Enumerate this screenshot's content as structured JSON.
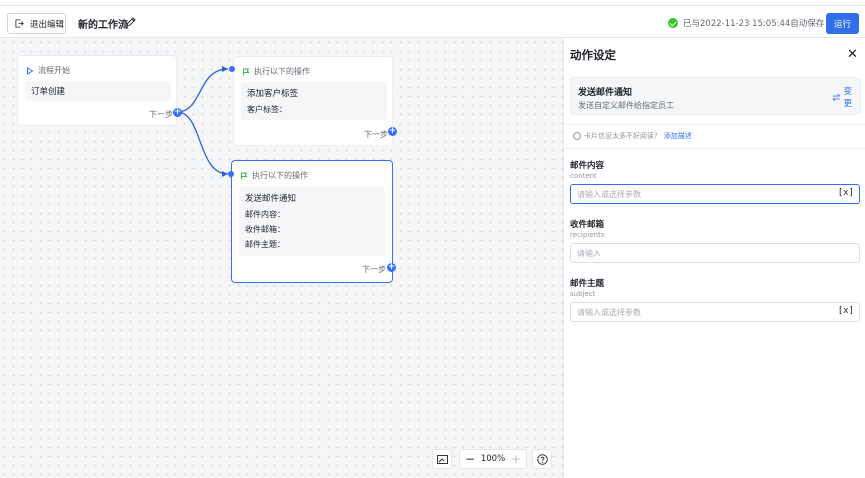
{
  "header": {
    "exit_label": "退出编辑",
    "title": "新的工作流",
    "save_status": "已与2022-11-23 15:05:44自动保存",
    "run_label": "运行"
  },
  "canvas": {
    "start_node": {
      "header": "流程开始",
      "title": "订单创建",
      "next": "下一步"
    },
    "node_tag": {
      "header": "执行以下的操作",
      "title": "添加客户标签",
      "fields": [
        "客户标签："
      ],
      "next": "下一步"
    },
    "node_email": {
      "header": "执行以下的操作",
      "title": "发送邮件通知",
      "fields": [
        "邮件内容：",
        "收件邮箱：",
        "邮件主题："
      ],
      "next": "下一步"
    },
    "zoom_level": "100%"
  },
  "panel": {
    "title": "动作设定",
    "action": {
      "name": "发送邮件通知",
      "desc": "发送自定义邮件给指定员工",
      "change_label": "变更"
    },
    "hint": {
      "text": "卡片信息太多不好阅读?",
      "link": "添加描述"
    },
    "fields": [
      {
        "label": "邮件内容",
        "key": "content",
        "placeholder": "请输入或选择参数",
        "var_button": "[x]"
      },
      {
        "label": "收件邮箱",
        "key": "recipients",
        "placeholder": "请输入"
      },
      {
        "label": "邮件主题",
        "key": "subject",
        "placeholder": "请输入或选择参数",
        "var_button": "[x]"
      }
    ]
  },
  "colors": {
    "primary": "#3370ff",
    "run_button": "#2f6fe8",
    "success": "#34c724"
  }
}
